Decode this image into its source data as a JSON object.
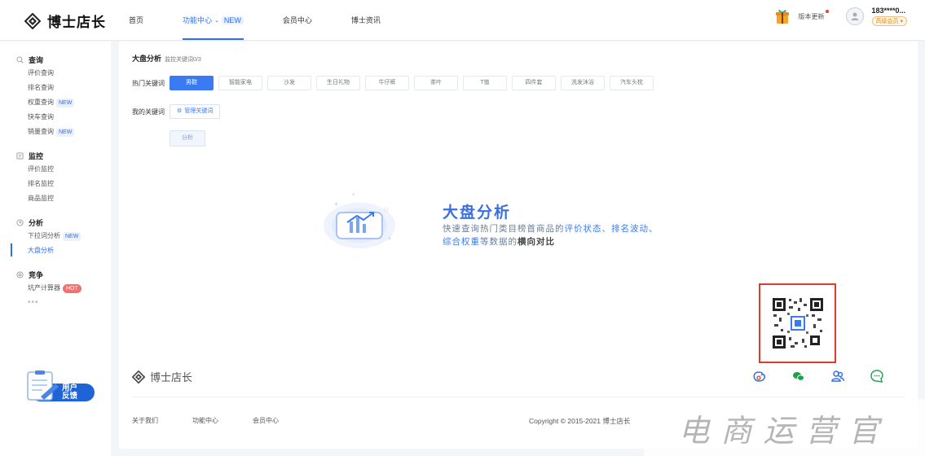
{
  "header": {
    "logo_text": "博士店长",
    "nav": [
      {
        "label": "首页"
      },
      {
        "label": "功能中心",
        "badge": "NEW"
      },
      {
        "label": "会员中心"
      },
      {
        "label": "博士资讯"
      }
    ],
    "version_label": "版本更新",
    "user_name": "183****0...",
    "member_badge": "高级会员 ▾"
  },
  "sidebar": {
    "groups": [
      {
        "title": "查询",
        "icon": "search-icon",
        "items": [
          {
            "label": "评价查询"
          },
          {
            "label": "排名查询"
          },
          {
            "label": "权重查询",
            "tag": "NEW"
          },
          {
            "label": "快车查询"
          },
          {
            "label": "销量查询",
            "tag": "NEW"
          }
        ]
      },
      {
        "title": "监控",
        "icon": "monitor-icon",
        "items": [
          {
            "label": "评价监控"
          },
          {
            "label": "排名监控"
          },
          {
            "label": "商品监控"
          }
        ]
      },
      {
        "title": "分析",
        "icon": "clock-icon",
        "items": [
          {
            "label": "下拉词分析",
            "tag": "NEW"
          },
          {
            "label": "大盘分析",
            "active": true
          }
        ]
      },
      {
        "title": "竞争",
        "icon": "target-icon",
        "items": [
          {
            "label": "坑产计算器",
            "tag": "HOT"
          }
        ]
      }
    ],
    "more": "•••",
    "feedback": [
      "用户",
      "反馈"
    ]
  },
  "main": {
    "title": "大盘分析",
    "subtitle": "监控关键词0/3",
    "hot_label": "热门关键词",
    "keywords": [
      "男鞋",
      "智能家电",
      "沙发",
      "生日礼物",
      "牛仔裤",
      "茶叶",
      "T恤",
      "四件套",
      "洗发沐浴",
      "汽车头枕"
    ],
    "active_keyword": "男鞋",
    "my_label": "我的关键词",
    "manage_label": "管理关键词",
    "analyze_label": "分析",
    "hero": {
      "title": "大盘分析",
      "line1_a": "快速查询热门类目榜首商品的",
      "line1_hl": "评价状态、排名波动、",
      "line2_hl": "综合权重",
      "line2_a": "等数据的",
      "line2_b": "横向对比"
    }
  },
  "footer": {
    "logo_text": "博士店长",
    "links": [
      "关于我们",
      "功能中心",
      "会员中心"
    ],
    "copyright": "Copyright © 2015-2021 博士店长"
  },
  "watermark": "电商运营官",
  "colors": {
    "accent": "#3a7bf3",
    "hot": "#f1716c",
    "qr_frame": "#e23a2a"
  }
}
